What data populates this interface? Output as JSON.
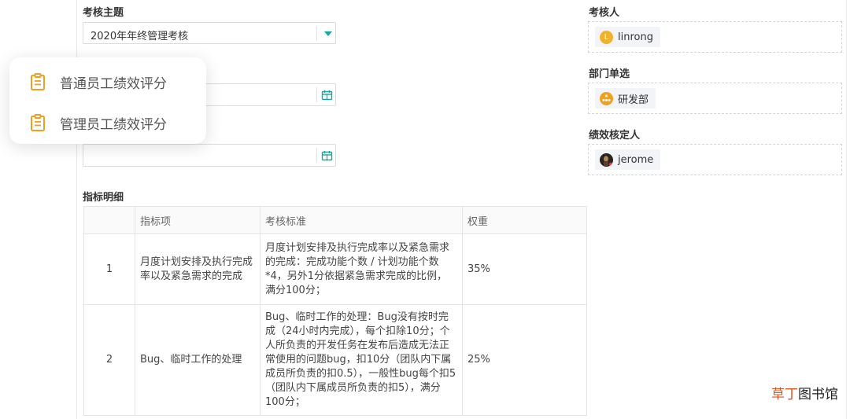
{
  "form": {
    "theme_label": "考核主题",
    "theme_value": "2020年年终管理考核",
    "assessor_label": "考核人",
    "assessor_name": "linrong",
    "assessor_avatar_letter": "L",
    "dept_label": "部门单选",
    "dept_name": "研发部",
    "approver_label": "绩效核定人",
    "approver_name": "jerome",
    "detail_label": "指标明细"
  },
  "popup": {
    "items": [
      {
        "label": "普通员工绩效评分",
        "icon": "clipboard-icon"
      },
      {
        "label": "管理员工绩效评分",
        "icon": "clipboard-icon"
      }
    ]
  },
  "table": {
    "headers": [
      "",
      "指标项",
      "考核标准",
      "权重"
    ],
    "rows": [
      {
        "no": "1",
        "item": "月度计划安排及执行完成率以及紧急需求的完成",
        "criteria": "月度计划安排及执行完成率以及紧急需求的完成：完成功能个数 / 计划功能个数*4，另外1分依据紧急需求完成的比例，满分100分；",
        "weight": "35%"
      },
      {
        "no": "2",
        "item": "Bug、临时工作的处理",
        "criteria": "Bug、临时工作的处理：Bug没有按时完成（24小时内完成），每个扣除10分；个人所负责的开发任务在发布后造成无法正常使用的问题bug，扣10分（团队内下属成员所负责的扣0.5），一般性bug每个扣5（团队内下属成员所负责的扣5），满分100分；",
        "weight": "25%"
      }
    ]
  },
  "watermark": {
    "highlight": "草丁",
    "rest": "图书馆"
  },
  "colors": {
    "accent": "#14a8a0",
    "icon_orange": "#f0a020"
  }
}
